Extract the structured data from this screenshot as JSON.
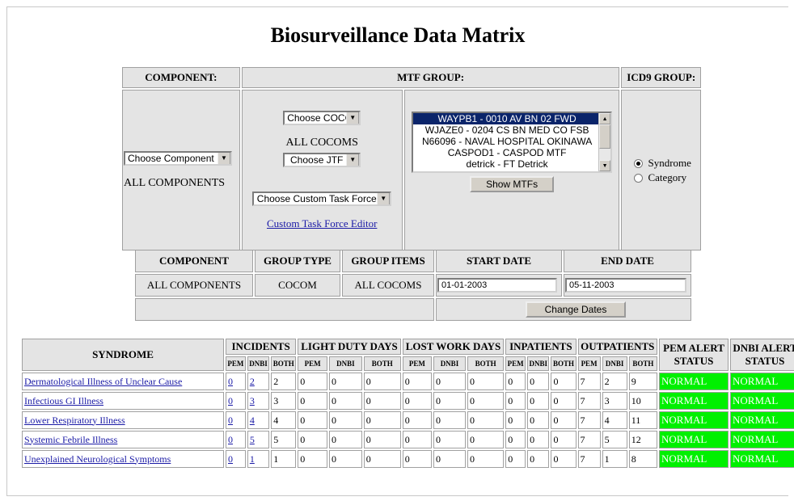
{
  "page": {
    "title": "Biosurveillance Data Matrix"
  },
  "selectors": {
    "component_header": "COMPONENT:",
    "mtf_group_header": "MTF GROUP:",
    "icd9_group_header": "ICD9 GROUP:",
    "component_select": "Choose Component",
    "component_value": "ALL COMPONENTS",
    "cocom_select": "Choose COCOM",
    "cocom_value": "ALL COCOMS",
    "jtf_select": "Choose JTF",
    "custom_tf_select": "Choose Custom Task Force",
    "custom_tf_link": "Custom Task Force Editor",
    "mtf_options": [
      "WAYPB1 - 0010 AV BN 02 FWD",
      "WJAZE0 - 0204 CS BN MED CO FSB",
      "N66096 - NAVAL HOSPITAL OKINAWA",
      "CASPOD1 - CASPOD MTF",
      "detrick - FT Detrick"
    ],
    "mtf_selected_index": 0,
    "show_mtfs_button": "Show MTFs",
    "icd9_options": [
      "Syndrome",
      "Category"
    ],
    "icd9_selected": "Syndrome"
  },
  "summary": {
    "headers": [
      "COMPONENT",
      "GROUP TYPE",
      "GROUP ITEMS",
      "START DATE",
      "END DATE"
    ],
    "component": "ALL COMPONENTS",
    "group_type": "COCOM",
    "group_items": "ALL COCOMS",
    "start_date": "01-01-2003",
    "end_date": "05-11-2003",
    "change_dates_button": "Change Dates"
  },
  "matrix": {
    "syndrome_header": "SYNDROME",
    "groups": [
      "INCIDENTS",
      "LIGHT DUTY DAYS",
      "LOST WORK DAYS",
      "INPATIENTS",
      "OUTPATIENTS"
    ],
    "sub_headers": [
      "PEM",
      "DNBI",
      "BOTH"
    ],
    "pem_alert_header": "PEM ALERT STATUS",
    "dnbi_alert_header": "DNBI ALERT STATUS",
    "rows": [
      {
        "name": "Dermatological Illness of Unclear Cause",
        "values": [
          "0",
          "2",
          "2",
          "0",
          "0",
          "0",
          "0",
          "0",
          "0",
          "0",
          "0",
          "0",
          "7",
          "2",
          "9"
        ],
        "pem": "NORMAL",
        "dnbi": "NORMAL"
      },
      {
        "name": "Infectious GI Illness",
        "values": [
          "0",
          "3",
          "3",
          "0",
          "0",
          "0",
          "0",
          "0",
          "0",
          "0",
          "0",
          "0",
          "7",
          "3",
          "10"
        ],
        "pem": "NORMAL",
        "dnbi": "NORMAL"
      },
      {
        "name": "Lower Respiratory Illness",
        "values": [
          "0",
          "4",
          "4",
          "0",
          "0",
          "0",
          "0",
          "0",
          "0",
          "0",
          "0",
          "0",
          "7",
          "4",
          "11"
        ],
        "pem": "NORMAL",
        "dnbi": "NORMAL"
      },
      {
        "name": "Systemic Febrile Illness",
        "values": [
          "0",
          "5",
          "5",
          "0",
          "0",
          "0",
          "0",
          "0",
          "0",
          "0",
          "0",
          "0",
          "7",
          "5",
          "12"
        ],
        "pem": "NORMAL",
        "dnbi": "NORMAL"
      },
      {
        "name": "Unexplained Neurological Symptoms",
        "values": [
          "0",
          "1",
          "1",
          "0",
          "0",
          "0",
          "0",
          "0",
          "0",
          "0",
          "0",
          "0",
          "7",
          "1",
          "8"
        ],
        "pem": "NORMAL",
        "dnbi": "NORMAL"
      }
    ]
  },
  "colors": {
    "normal_status": "#00f000",
    "link": "#1a1aa6",
    "cell_bg": "#e4e4e4"
  }
}
